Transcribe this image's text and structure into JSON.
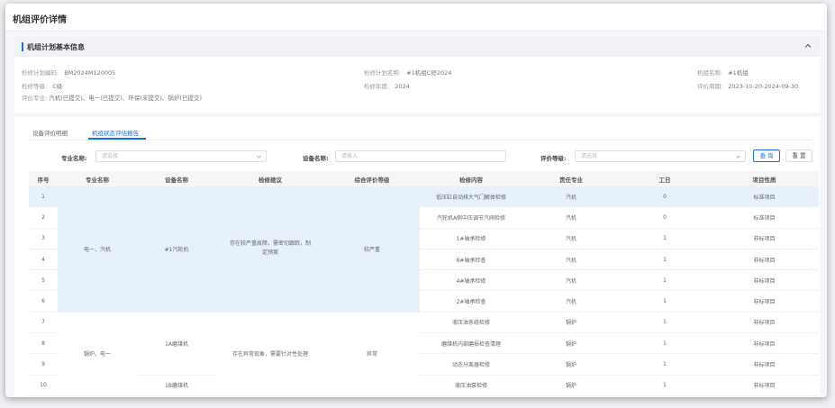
{
  "page": {
    "title": "机组评价详情"
  },
  "basic": {
    "section_title": "机组计划基本信息",
    "plan_no_label": "检修计划编码:",
    "plan_no": "BM2024M120005",
    "plan_name_label": "检修计划名称:",
    "plan_name": "#1机组C修2024",
    "unit_name_label": "机组名称:",
    "unit_name": "#1机组",
    "level_label": "检修等级:",
    "level": "C级",
    "year_label": "检修年度:",
    "year": "2024",
    "period_label": "评价周期:",
    "period": "2023-10-20-2024-09-30",
    "specialty_label": "评价专业:",
    "specialty": "汽机(已提交)、电一(已提交)、环保(未提交)、锅炉(已提交)"
  },
  "tabs": {
    "tab1": "设备评价明细",
    "tab2": "机组状态评估报告"
  },
  "filters": {
    "specialty_label": "专业名称:",
    "specialty_placeholder": "请选择",
    "device_label": "设备名称:",
    "device_placeholder": "请输入",
    "grade_label": "评价等级:",
    "grade_placeholder": "请选择",
    "query": "查 询",
    "reset": "重 置"
  },
  "table": {
    "headers": [
      "序号",
      "专业名称",
      "设备名称",
      "检修建议",
      "综合评价等级",
      "检修内容",
      "责任专业",
      "工日",
      "项目性质"
    ],
    "rows": [
      {
        "no": "1",
        "content": "低压缸自动排大气门解体检修",
        "resp": "汽机",
        "days": "0",
        "nature": "标准项目"
      },
      {
        "no": "2",
        "content": "汽轮机A侧中压调节汽阀检修",
        "resp": "汽机",
        "days": "0",
        "nature": "标准项目"
      },
      {
        "no": "3",
        "content": "1#轴承检修",
        "resp": "汽机",
        "days": "1",
        "nature": "非标项目"
      },
      {
        "no": "4",
        "content": "8#轴承检查",
        "resp": "汽机",
        "days": "1",
        "nature": "非标项目"
      },
      {
        "no": "5",
        "content": "4#轴承检修",
        "resp": "汽机",
        "days": "1",
        "nature": "非标项目"
      },
      {
        "no": "6",
        "content": "2#轴承检查",
        "resp": "汽机",
        "days": "1",
        "nature": "非标项目"
      },
      {
        "no": "7",
        "content": "液压油系统检修",
        "resp": "锅炉",
        "days": "1",
        "nature": "非标项目"
      },
      {
        "no": "8",
        "content": "磨煤机内部磨损检查清理",
        "resp": "锅炉",
        "days": "1",
        "nature": "非标项目"
      },
      {
        "no": "9",
        "content": "动态分离器检修",
        "resp": "锅炉",
        "days": "1",
        "nature": "非标项目"
      },
      {
        "no": "10",
        "content": "液压油泵检修",
        "resp": "锅炉",
        "days": "1",
        "nature": "非标项目"
      }
    ],
    "group1": {
      "specialty": "电一、汽机",
      "device": "#1汽轮机",
      "suggestion": "存在较严重故障，需密切跟踪，制定预案",
      "grade": "较严重"
    },
    "group2": {
      "specialty": "锅炉、电一",
      "device1": "1A磨煤机",
      "device2": "1B磨煤机",
      "suggestion": "存在异常现象，需要针对性处理",
      "grade": "异常"
    }
  },
  "colors": {
    "accent": "#1e6fd9",
    "warning": "#e98b2a",
    "highlight_row": "#e6f1fc"
  }
}
